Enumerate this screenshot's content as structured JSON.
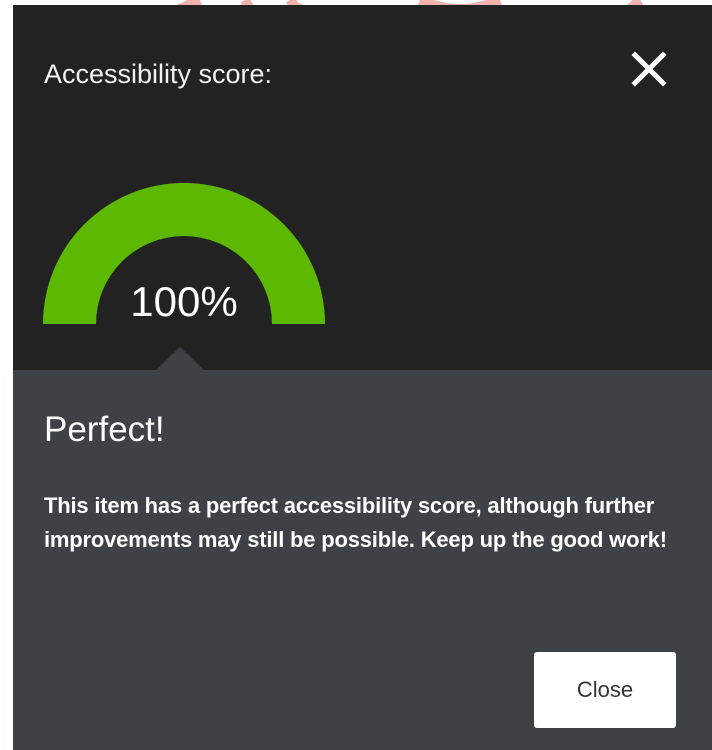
{
  "dialog": {
    "title": "Accessibility score:",
    "close_icon": "close-x-icon"
  },
  "gauge": {
    "value_label": "100%",
    "fill_fraction": 1.0,
    "color": "#5cb800"
  },
  "result": {
    "title": "Perfect!",
    "text": "This item has a perfect accessibility score, although further improvements may still be possible. Keep up the good work!"
  },
  "footer": {
    "close_label": "Close"
  },
  "colors": {
    "header_bg": "#222222",
    "body_bg": "#3e4145",
    "watermark": "#e85a4f"
  }
}
